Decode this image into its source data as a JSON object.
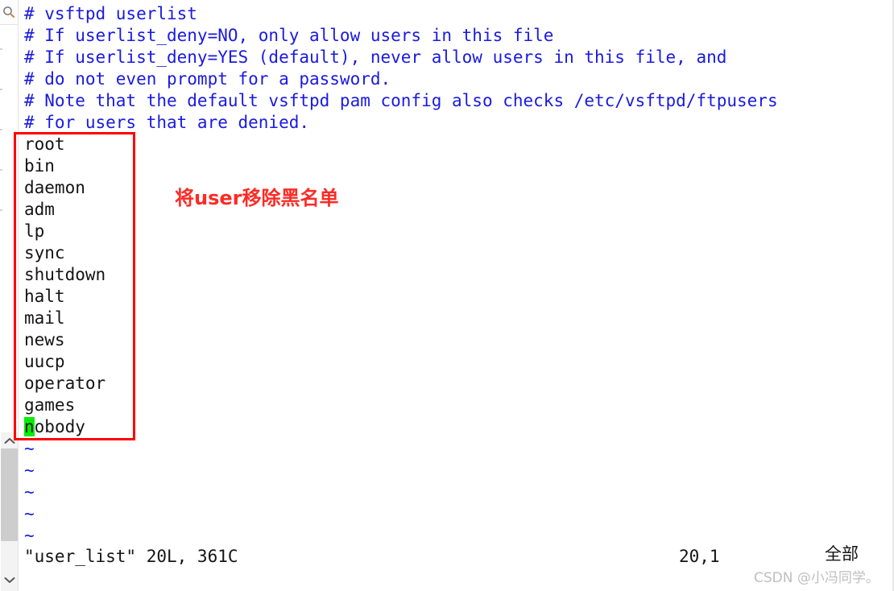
{
  "window": {
    "title": "user_list"
  },
  "gutter": {
    "search_icon": "search-icon",
    "scroll_up_icon": "chevron-up-icon",
    "scroll_down_icon": "chevron-down-icon"
  },
  "editor": {
    "comments": [
      "# vsftpd userlist",
      "# If userlist_deny=NO, only allow users in this file",
      "# If userlist_deny=YES (default), never allow users in this file, and",
      "# do not even prompt for a password.",
      "# Note that the default vsftpd pam config also checks /etc/vsftpd/ftpusers",
      "# for users that are denied."
    ],
    "users": [
      "root",
      "bin",
      "daemon",
      "adm",
      "lp",
      "sync",
      "shutdown",
      "halt",
      "mail",
      "news",
      "uucp",
      "operator",
      "games"
    ],
    "cursor_line": {
      "cursor_char": "n",
      "rest": "obody"
    },
    "empty_markers": [
      "~",
      "~",
      "~",
      "~",
      "~"
    ]
  },
  "annotation": {
    "text": "将user移除黑名单",
    "color": "#fc2b25",
    "box_color": "#ff0000"
  },
  "status": {
    "file_info": "\"user_list\" 20L, 361C",
    "position": "20,1",
    "scroll_state": "全部"
  },
  "watermark": {
    "text": "CSDN @小冯同学。"
  },
  "colors": {
    "comment": "#1a1ae0",
    "text": "#141414",
    "cursor_highlight": "#00f000",
    "annotation_red": "#ff0000"
  }
}
